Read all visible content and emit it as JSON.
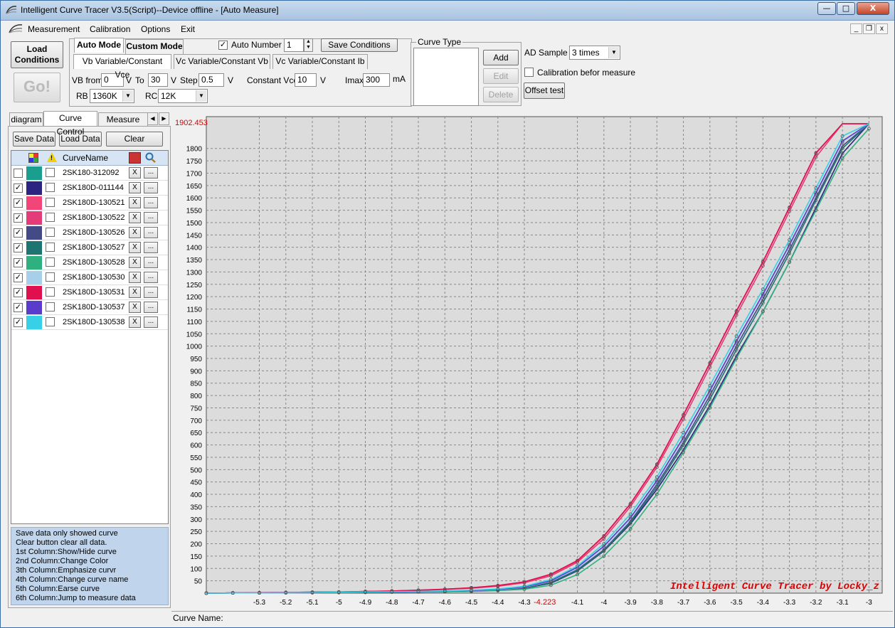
{
  "window": {
    "title": "Intelligent Curve Tracer V3.5(Script)--Device offline - [Auto Measure]",
    "minimize": "—",
    "maximize": "□",
    "close": "X"
  },
  "menu": [
    "Measurement",
    "Calibration",
    "Options",
    "Exit"
  ],
  "load_conditions": "Load Conditions",
  "go": "Go!",
  "mode_tabs": [
    "Auto Mode",
    "Custom Mode"
  ],
  "sub_tabs": [
    "Vb Variable/Constant Vce",
    "Vc Variable/Constant Vb",
    "Vc Variable/Constant Ib"
  ],
  "auto_number": {
    "label": "Auto Number",
    "checked": "✓",
    "value": "1"
  },
  "save_conditions": "Save Conditions",
  "vb_from": {
    "label": "VB from",
    "value": "0",
    "unit": "V"
  },
  "vb_to": {
    "label": "To",
    "value": "30",
    "unit": "V"
  },
  "vb_step": {
    "label": "Step",
    "value": "0.5",
    "unit": "V"
  },
  "constant_vce": {
    "label": "Constant Vce",
    "value": "10",
    "unit": "V"
  },
  "imax": {
    "label": "Imax",
    "value": "300",
    "unit": "mA"
  },
  "rb": {
    "label": "RB",
    "value": "1360K"
  },
  "rc": {
    "label": "RC",
    "value": "12K"
  },
  "curve_type": {
    "label": "Curve Type",
    "add": "Add",
    "edit": "Edit",
    "delete": "Delete"
  },
  "ad_sample": {
    "label": "AD Sample",
    "value": "3 times"
  },
  "calibration": {
    "label": "Calibration befor measure"
  },
  "offset_test": "Offset test",
  "left_tabs": [
    "diagram",
    "Curve Control",
    "Measure Data"
  ],
  "left_tab_arrows": [
    "◀",
    "▶"
  ],
  "save_data": "Save Data",
  "load_data": "Load Data",
  "clear": "Clear",
  "grid": {
    "header_name": "CurveName",
    "header_warn": "!",
    "x_label": "X",
    "dots_label": "...",
    "rows": [
      {
        "name": "2SK180-312092",
        "color": "#1b9e8e",
        "shown": ""
      },
      {
        "name": "2SK180D-011144",
        "color": "#2b2480",
        "shown": "✓"
      },
      {
        "name": "2SK180D-130521",
        "color": "#f2467a",
        "shown": "✓"
      },
      {
        "name": "2SK180D-130522",
        "color": "#e33c78",
        "shown": "✓"
      },
      {
        "name": "2SK180D-130526",
        "color": "#444a85",
        "shown": "✓"
      },
      {
        "name": "2SK180D-130527",
        "color": "#1d7470",
        "shown": "✓"
      },
      {
        "name": "2SK180D-130528",
        "color": "#2fb080",
        "shown": "✓"
      },
      {
        "name": "2SK180D-130530",
        "color": "#a7cfea",
        "shown": "✓"
      },
      {
        "name": "2SK180D-130531",
        "color": "#e0104e",
        "shown": "✓"
      },
      {
        "name": "2SK180D-130537",
        "color": "#5a3ccc",
        "shown": "✓"
      },
      {
        "name": "2SK180D-130538",
        "color": "#38d0e6",
        "shown": "✓"
      }
    ]
  },
  "help_lines": [
    "Save data only showed curve",
    "Clear button clear all data.",
    "1st Column:Show/Hide curve",
    "2nd Column:Change Color",
    "3th Column:Emphasize curvr",
    "4th Column:Change curve name",
    "5th Column:Earse curve",
    "6th Column:Jump to measure data"
  ],
  "status": {
    "curve_name_label": "Curve Name:"
  },
  "chart_data": {
    "type": "line",
    "watermark": "Intelligent Curve Tracer by Locky_z",
    "cursor_y_label": "1902.453",
    "cursor_x_label": "-4.223",
    "xlim": [
      -5.5,
      -2.95
    ],
    "ylim": [
      0,
      1900
    ],
    "x_ticks": [
      "-5.3",
      "-5.2",
      "-5.1",
      "-5",
      "-4.9",
      "-4.8",
      "-4.7",
      "-4.6",
      "-4.5",
      "-4.4",
      "-4.3",
      "-4.1",
      "-4",
      "-3.9",
      "-3.8",
      "-3.7",
      "-3.6",
      "-3.5",
      "-3.4",
      "-3.3",
      "-3.2",
      "-3.1",
      "-3"
    ],
    "y_ticks": [
      50,
      100,
      150,
      200,
      250,
      300,
      350,
      400,
      450,
      500,
      550,
      600,
      650,
      700,
      750,
      800,
      850,
      900,
      950,
      1000,
      1050,
      1100,
      1150,
      1200,
      1250,
      1300,
      1350,
      1400,
      1450,
      1500,
      1550,
      1600,
      1650,
      1700,
      1750,
      1800
    ],
    "grid": true,
    "x": [
      -5.5,
      -5.4,
      -5.3,
      -5.2,
      -5.1,
      -5.0,
      -4.9,
      -4.8,
      -4.7,
      -4.6,
      -4.5,
      -4.4,
      -4.3,
      -4.2,
      -4.1,
      -4.0,
      -3.9,
      -3.8,
      -3.7,
      -3.6,
      -3.5,
      -3.4,
      -3.3,
      -3.2,
      -3.1,
      -3.0
    ],
    "series": [
      {
        "color": "#2b2480",
        "values": [
          0,
          1,
          1,
          2,
          2,
          3,
          3,
          4,
          5,
          6,
          8,
          12,
          20,
          40,
          90,
          170,
          280,
          420,
          580,
          760,
          960,
          1140,
          1340,
          1560,
          1780,
          1900
        ]
      },
      {
        "color": "#f2467a",
        "values": [
          0,
          1,
          2,
          3,
          4,
          5,
          7,
          9,
          12,
          16,
          22,
          30,
          45,
          75,
          130,
          230,
          360,
          520,
          720,
          930,
          1140,
          1340,
          1560,
          1780,
          1900,
          1900
        ]
      },
      {
        "color": "#e33c78",
        "values": [
          0,
          1,
          2,
          3,
          4,
          5,
          6,
          8,
          11,
          15,
          20,
          28,
          42,
          70,
          125,
          220,
          350,
          510,
          705,
          915,
          1125,
          1325,
          1545,
          1765,
          1900,
          1900
        ]
      },
      {
        "color": "#444a85",
        "values": [
          0,
          1,
          1,
          2,
          2,
          3,
          4,
          5,
          6,
          7,
          9,
          13,
          22,
          44,
          95,
          175,
          290,
          440,
          610,
          800,
          1000,
          1190,
          1390,
          1600,
          1810,
          1900
        ]
      },
      {
        "color": "#1d7470",
        "values": [
          0,
          1,
          1,
          2,
          2,
          3,
          4,
          5,
          6,
          7,
          9,
          13,
          21,
          42,
          92,
          172,
          285,
          430,
          600,
          785,
          985,
          1175,
          1375,
          1590,
          1800,
          1900
        ]
      },
      {
        "color": "#2fb080",
        "values": [
          0,
          1,
          1,
          1,
          2,
          2,
          3,
          4,
          5,
          6,
          7,
          10,
          16,
          32,
          75,
          150,
          260,
          400,
          570,
          750,
          950,
          1140,
          1340,
          1550,
          1760,
          1880
        ]
      },
      {
        "color": "#a7cfea",
        "values": [
          0,
          1,
          1,
          2,
          2,
          3,
          4,
          5,
          6,
          8,
          10,
          14,
          24,
          48,
          100,
          185,
          300,
          450,
          625,
          815,
          1015,
          1205,
          1405,
          1615,
          1825,
          1900
        ]
      },
      {
        "color": "#e0104e",
        "values": [
          0,
          1,
          2,
          3,
          4,
          5,
          7,
          9,
          12,
          16,
          22,
          31,
          46,
          77,
          132,
          232,
          362,
          522,
          722,
          932,
          1142,
          1342,
          1562,
          1782,
          1900,
          1900
        ]
      },
      {
        "color": "#5a3ccc",
        "values": [
          0,
          1,
          1,
          2,
          2,
          3,
          4,
          5,
          6,
          8,
          10,
          15,
          25,
          50,
          105,
          190,
          305,
          455,
          630,
          820,
          1020,
          1210,
          1410,
          1620,
          1830,
          1900
        ]
      },
      {
        "color": "#38d0e6",
        "values": [
          0,
          1,
          1,
          2,
          3,
          4,
          5,
          6,
          7,
          9,
          12,
          17,
          28,
          55,
          110,
          200,
          320,
          470,
          650,
          840,
          1040,
          1230,
          1430,
          1640,
          1850,
          1900
        ]
      }
    ]
  }
}
